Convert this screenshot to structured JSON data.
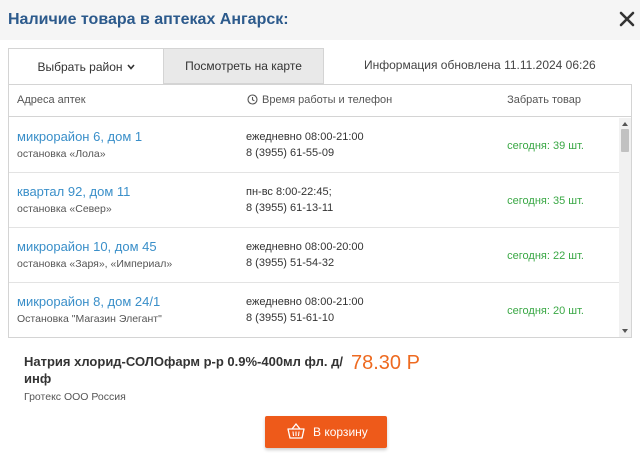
{
  "header": {
    "title": "Наличие товара в аптеках Ангарск:"
  },
  "tabs": {
    "district": "Выбрать район",
    "map": "Посмотреть на карте"
  },
  "updated": "Информация обновлена 11.11.2024 06:26",
  "table": {
    "col_address": "Адреса аптек",
    "col_hours": "Время работы и телефон",
    "col_take": "Забрать товар",
    "rows": [
      {
        "address": "микрорайон 6, дом 1",
        "stop": "остановка «Лола»",
        "hours": "ежедневно 08:00-21:00",
        "phone": "8 (3955) 61-55-09",
        "stock": "сегодня: 39 шт."
      },
      {
        "address": "квартал 92, дом 11",
        "stop": "остановка «Север»",
        "hours": "пн-вс 8:00-22:45;",
        "phone": "8 (3955) 61-13-11",
        "stock": "сегодня: 35 шт."
      },
      {
        "address": "микрорайон 10, дом 45",
        "stop": "остановка «Заря», «Империал»",
        "hours": "ежедневно 08:00-20:00",
        "phone": "8 (3955) 51-54-32",
        "stock": "сегодня: 22 шт."
      },
      {
        "address": "микрорайон 8, дом 24/1",
        "stop": "Остановка \"Магазин Элегант\"",
        "hours": "ежедневно 08:00-21:00",
        "phone": "8 (3955) 51-61-10",
        "stock": "сегодня: 20 шт."
      }
    ]
  },
  "product": {
    "name": "Натрия хлорид-СОЛОфарм р-р 0.9%-400мл фл. д/инф",
    "maker": "Гротекс ООО Россия",
    "price": "78.30 Р",
    "cart_label": "В корзину"
  },
  "colors": {
    "title": "#2c5a8c",
    "link": "#3a8fc9",
    "stock": "#3aa845",
    "price": "#ee6a20",
    "button": "#ee5a1a"
  },
  "icons": {
    "close": "close-icon",
    "chevron": "chevron-down-icon",
    "clock": "clock-icon",
    "basket": "basket-icon"
  }
}
